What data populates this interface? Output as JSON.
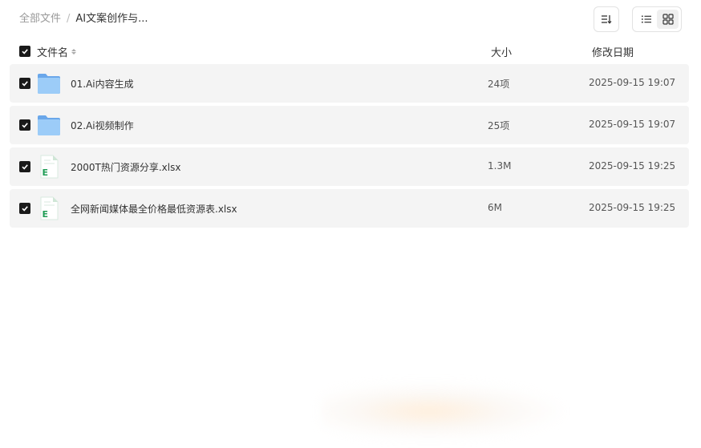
{
  "breadcrumb": {
    "root": "全部文件",
    "separator": "/",
    "current": "AI文案创作与..."
  },
  "toolbar": {
    "sort_icon": "sort-icon",
    "list_view_icon": "list-view-icon",
    "grid_view_icon": "grid-view-icon",
    "active_view": "grid"
  },
  "table": {
    "headers": {
      "name": "文件名",
      "size": "大小",
      "date": "修改日期"
    },
    "rows": [
      {
        "type": "folder",
        "icon": "folder-icon",
        "name": "01.Ai内容生成",
        "size": "24项",
        "date": "2025-09-15 19:07",
        "checked": true
      },
      {
        "type": "folder",
        "icon": "folder-icon",
        "name": "02.Ai视频制作",
        "size": "25项",
        "date": "2025-09-15 19:07",
        "checked": true
      },
      {
        "type": "excel",
        "icon": "excel-file-icon",
        "name": "2000T热门资源分享.xlsx",
        "size": "1.3M",
        "date": "2025-09-15 19:25",
        "checked": true
      },
      {
        "type": "excel",
        "icon": "excel-file-icon",
        "name": "全网新闻媒体最全价格最低资源表.xlsx",
        "size": "6M",
        "date": "2025-09-15 19:25",
        "checked": true
      }
    ]
  },
  "colors": {
    "row_bg": "#f4f4f4",
    "checkbox": "#1a1a1a",
    "folder": "#7cb4ee",
    "excel_green": "#1f9d55"
  }
}
